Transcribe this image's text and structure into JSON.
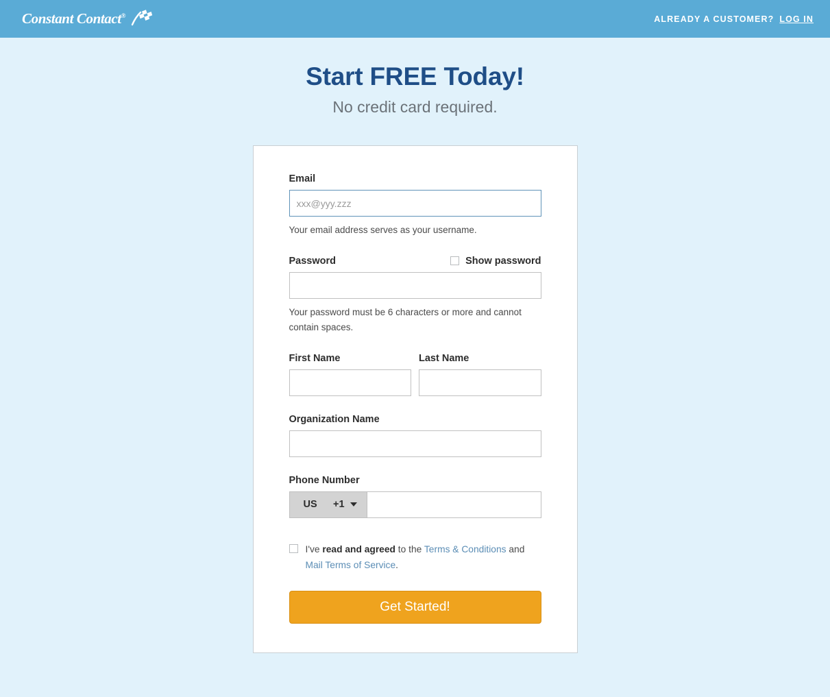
{
  "header": {
    "brand_name": "Constant Contact",
    "brand_reg": "®",
    "brand_mark_icon": "checkered-flag-icon",
    "customer_prompt": "ALREADY A CUSTOMER?",
    "login_label": "LOG IN",
    "bg_color": "#5aabd6"
  },
  "hero": {
    "title": "Start FREE Today!",
    "subtitle": "No credit card required.",
    "title_color": "#1f4e87"
  },
  "form": {
    "email": {
      "label": "Email",
      "placeholder": "xxx@yyy.zzz",
      "value": "",
      "help": "Your email address serves as your username.",
      "focus_border_color": "#5f93b8"
    },
    "password": {
      "label": "Password",
      "show_password_label": "Show password",
      "show_password_checked": false,
      "value": "",
      "help": "Your password must be 6 characters or more and cannot contain spaces."
    },
    "first_name": {
      "label": "First Name",
      "value": ""
    },
    "last_name": {
      "label": "Last Name",
      "value": ""
    },
    "organization": {
      "label": "Organization Name",
      "value": ""
    },
    "phone": {
      "label": "Phone Number",
      "country_code_label": "US",
      "dial_code": "+1",
      "caret_icon": "chevron-down-icon",
      "value": ""
    },
    "terms": {
      "checked": false,
      "prefix": "I've ",
      "bold": "read and agreed",
      "middle": " to the ",
      "link1": "Terms & Conditions",
      "conjunction": " and ",
      "link2": "Mail Terms of Service",
      "suffix": ".",
      "link_color": "#5b8db5"
    },
    "submit_label": "Get Started!",
    "submit_color": "#efa31e"
  },
  "page": {
    "background_color": "#e1f2fb",
    "card_background": "#ffffff",
    "card_border_color": "#c9cfd3"
  }
}
